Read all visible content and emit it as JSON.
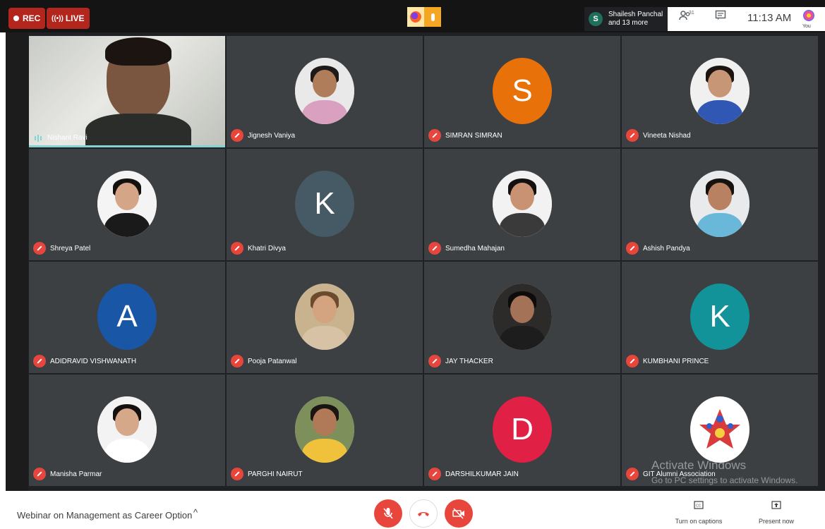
{
  "topbar": {
    "rec_label": "REC",
    "live_label": "LIVE",
    "presenter_initial": "S",
    "presenter_line1": "Shailesh Panchal",
    "presenter_line2": "and 13 more",
    "people_count": "31",
    "time": "11:13 AM",
    "you_label": "You"
  },
  "tiles": [
    {
      "name": "Nishant Ravi",
      "kind": "camera"
    },
    {
      "name": "Jignesh Vaniya",
      "kind": "photo",
      "skin": "#b07d5b",
      "hair": "#1d1a18",
      "shirt": "#d9a0c0",
      "bg": "#e9e9e9"
    },
    {
      "name": "SIMRAN SIMRAN",
      "kind": "letter",
      "letter": "S",
      "color": "#e8710a"
    },
    {
      "name": "Vineeta Nishad",
      "kind": "photo",
      "skin": "#c79676",
      "hair": "#1b1410",
      "shirt": "#2f57b3",
      "bg": "#f0f0f0"
    },
    {
      "name": "Shreya Patel",
      "kind": "photo",
      "skin": "#d5a588",
      "hair": "#14100e",
      "shirt": "#1a1a1a",
      "bg": "#f4f4f4"
    },
    {
      "name": "Khatri Divya",
      "kind": "letter",
      "letter": "K",
      "color": "#455a64"
    },
    {
      "name": "Sumedha Mahajan",
      "kind": "photo",
      "skin": "#c99373",
      "hair": "#151010",
      "shirt": "#3a3a3a",
      "bg": "#f2f2f2"
    },
    {
      "name": "Ashish Pandya",
      "kind": "photo",
      "skin": "#b88262",
      "hair": "#151210",
      "shirt": "#69b7d9",
      "bg": "#e8eaec"
    },
    {
      "name": "ADIDRAVID VISHWANATH",
      "kind": "letter",
      "letter": "A",
      "color": "#1a56a6"
    },
    {
      "name": "Pooja Patanwal",
      "kind": "photo",
      "skin": "#d4a37f",
      "hair": "#6b4a2e",
      "shirt": "#d8c2a6",
      "bg": "#c9b38f"
    },
    {
      "name": "JAY THACKER",
      "kind": "photo",
      "skin": "#a47256",
      "hair": "#0e0c0b",
      "shirt": "#1d1d1d",
      "bg": "#2d2b29"
    },
    {
      "name": "KUMBHANI PRINCE",
      "kind": "letter",
      "letter": "K",
      "color": "#12939a"
    },
    {
      "name": "Manisha Parmar",
      "kind": "photo",
      "skin": "#d6a88a",
      "hair": "#141010",
      "shirt": "#ffffff",
      "bg": "#f3f3f3"
    },
    {
      "name": "PARGHI NAIRUT",
      "kind": "photo",
      "skin": "#b07a58",
      "hair": "#1a1512",
      "shirt": "#f0c23b",
      "bg": "#7d8f5a"
    },
    {
      "name": "DARSHILKUMAR JAIN",
      "kind": "letter",
      "letter": "D",
      "color": "#e02045"
    },
    {
      "name": "GIT Alumni Association",
      "kind": "logo"
    }
  ],
  "watermark": {
    "line1": "Activate Windows",
    "line2": "Go to PC settings to activate Windows."
  },
  "bottombar": {
    "meeting_title": "Webinar on Management as Career Option",
    "captions_label": "Turn on captions",
    "present_label": "Present now"
  },
  "icons": {
    "rec": "record-dot-icon",
    "live": "broadcast-icon",
    "people": "people-icon",
    "chat": "chat-icon",
    "mic_off": "mic-off-icon",
    "hangup": "hang-up-icon",
    "cam_off": "camera-off-icon",
    "captions": "captions-icon",
    "present": "present-icon",
    "chevron_up": "chevron-up-icon"
  }
}
